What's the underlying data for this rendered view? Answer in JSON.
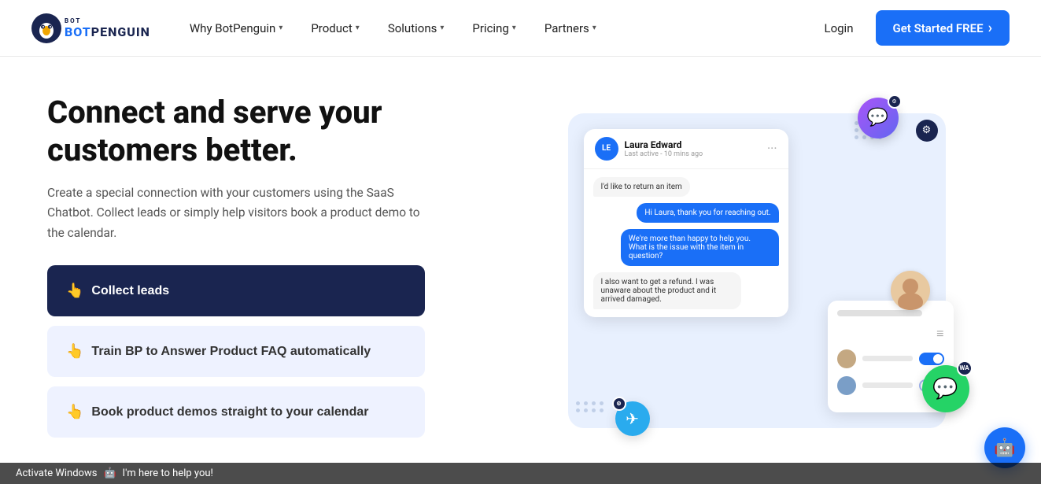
{
  "brand": {
    "name_top": "BOT",
    "name_bottom": "PENGUIN",
    "logo_icon": "🐧"
  },
  "navbar": {
    "links": [
      {
        "label": "Why BotPenguin",
        "has_chevron": true
      },
      {
        "label": "Product",
        "has_chevron": true
      },
      {
        "label": "Solutions",
        "has_chevron": true
      },
      {
        "label": "Pricing",
        "has_chevron": true
      },
      {
        "label": "Partners",
        "has_chevron": true
      }
    ],
    "login_label": "Login",
    "cta_label": "Get Started FREE",
    "cta_icon": "›"
  },
  "hero": {
    "heading_line1": "Connect and serve your",
    "heading_line2": "customers better.",
    "subtext": "Create a special connection with your customers using the SaaS Chatbot. Collect leads or simply help visitors book a product demo to the calendar.",
    "features": [
      {
        "id": "collect-leads",
        "icon": "👆",
        "label": "Collect leads",
        "active": true
      },
      {
        "id": "train-faq",
        "icon": "👆",
        "label": "Train BP to Answer Product FAQ automatically",
        "active": false
      },
      {
        "id": "book-demos",
        "icon": "👆",
        "label": "Book product demos straight to your calendar",
        "active": false
      }
    ]
  },
  "chat_demo": {
    "user_name": "Laura Edward",
    "user_status": "Last active - 10 mins ago",
    "avatar_initials": "LE",
    "messages": [
      {
        "side": "left",
        "text": "I'd like to return an item"
      },
      {
        "side": "right",
        "text": "Hi Laura, thank you for reaching out."
      },
      {
        "side": "right",
        "text": "We're more than happy to help you. What is the issue with the item in question?"
      },
      {
        "side": "left",
        "text": "I also want to get a refund. I was unaware about the product and it arrived damaged."
      }
    ]
  },
  "chatbot_bubble": {
    "icon": "🤖",
    "help_text": "I'm here to help you!"
  },
  "colors": {
    "primary": "#1a6ff7",
    "dark_navy": "#1a2550",
    "light_blue_bg": "#e8f0fe",
    "active_btn_bg": "#1a2550",
    "inactive_btn_bg": "#eef2ff"
  }
}
